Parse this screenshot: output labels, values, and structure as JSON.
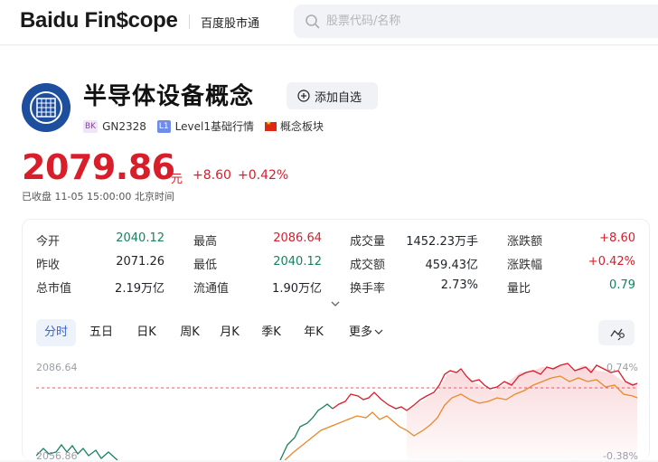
{
  "topbar": {
    "logo_text": "Baidu Fin$cope",
    "logo_sub": "百度股市通",
    "search_placeholder": "股票代码/名称"
  },
  "header": {
    "title": "半导体设备概念",
    "fav_label": "添加自选",
    "tags": [
      {
        "badge": "BK",
        "label": "GN2328"
      },
      {
        "badge": "L1",
        "label": "Level1基础行情"
      },
      {
        "badge": "",
        "label": "概念板块"
      }
    ],
    "price": "2079.86",
    "unit": "元",
    "change": "+8.60",
    "change_pct": "+0.42%",
    "status": "已收盘  11-05 15:00:00 北京时间"
  },
  "stats": [
    [
      {
        "k": "今开",
        "v": "2040.12",
        "c": "green"
      },
      {
        "k": "最高",
        "v": "2086.64",
        "c": "red"
      },
      {
        "k": "成交量",
        "v": "1452.23万手",
        "c": "dark"
      },
      {
        "k": "涨跌额",
        "v": "+8.60",
        "c": "red"
      }
    ],
    [
      {
        "k": "昨收",
        "v": "2071.26",
        "c": "dark"
      },
      {
        "k": "最低",
        "v": "2040.12",
        "c": "green"
      },
      {
        "k": "成交额",
        "v": "459.43亿",
        "c": "dark"
      },
      {
        "k": "涨跌幅",
        "v": "+0.42%",
        "c": "red"
      }
    ],
    [
      {
        "k": "总市值",
        "v": "2.19万亿",
        "c": "dark"
      },
      {
        "k": "流通值",
        "v": "1.90万亿",
        "c": "dark"
      },
      {
        "k": "换手率",
        "v": "2.73%",
        "c": "dark"
      },
      {
        "k": "量比",
        "v": "0.79",
        "c": "green"
      }
    ]
  ],
  "tabs": [
    "分时",
    "五日",
    "日K",
    "周K",
    "月K",
    "季K",
    "年K",
    "更多"
  ],
  "chart": {
    "y_top_label": "2086.64",
    "y_bottom_label": "2056.86",
    "pct_top_label": "0.74%",
    "pct_bottom_label": "-0.38%"
  },
  "colors": {
    "up": "#d81e2b",
    "down": "#198061",
    "accent": "#3a66d6",
    "avg_line": "#e8892b"
  }
}
